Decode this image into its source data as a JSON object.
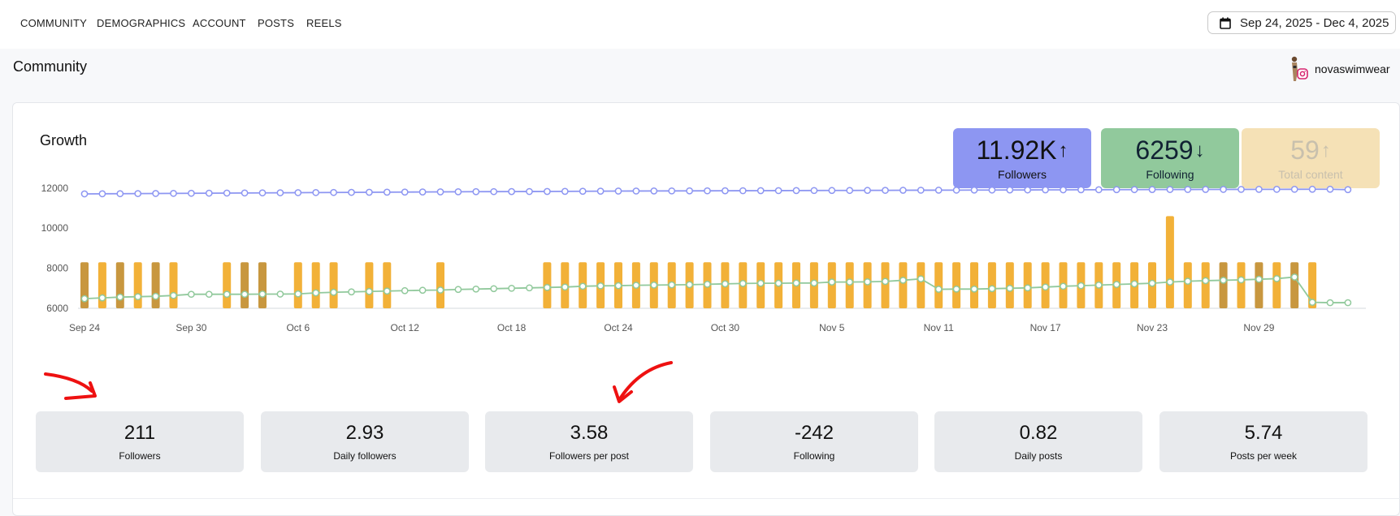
{
  "nav": {
    "tabs": [
      "COMMUNITY",
      "DEMOGRAPHICS",
      "ACCOUNT",
      "POSTS",
      "REELS"
    ],
    "date_range": "Sep 24, 2025 - Dec 4, 2025"
  },
  "page": {
    "title": "Community",
    "account_name": "novaswimwear"
  },
  "growth": {
    "title": "Growth",
    "kpis": [
      {
        "value": "11.92K",
        "arrow": "↑",
        "label": "Followers",
        "color": "#8d96f2"
      },
      {
        "value": "6259",
        "arrow": "↓",
        "label": "Following",
        "color": "#91c99c"
      },
      {
        "value": "59",
        "arrow": "↑",
        "label": "Total content",
        "color": "#f5e1b6"
      }
    ],
    "stats": [
      {
        "value": "211",
        "label": "Followers"
      },
      {
        "value": "2.93",
        "label": "Daily followers"
      },
      {
        "value": "3.58",
        "label": "Followers per post"
      },
      {
        "value": "-242",
        "label": "Following"
      },
      {
        "value": "0.82",
        "label": "Daily posts"
      },
      {
        "value": "5.74",
        "label": "Posts per week"
      }
    ]
  },
  "chart_data": {
    "type": "line",
    "y_ticks": [
      6000,
      8000,
      10000,
      12000
    ],
    "ylim": [
      6000,
      12000
    ],
    "x_tick_labels": [
      "Sep 24",
      "Sep 30",
      "Oct 6",
      "Oct 12",
      "Oct 18",
      "Oct 24",
      "Oct 30",
      "Nov 5",
      "Nov 11",
      "Nov 17",
      "Nov 23",
      "Nov 29"
    ],
    "x": [
      "Sep 24",
      "Sep 25",
      "Sep 26",
      "Sep 27",
      "Sep 28",
      "Sep 29",
      "Sep 30",
      "Oct 1",
      "Oct 2",
      "Oct 3",
      "Oct 4",
      "Oct 5",
      "Oct 6",
      "Oct 7",
      "Oct 8",
      "Oct 9",
      "Oct 10",
      "Oct 11",
      "Oct 12",
      "Oct 13",
      "Oct 14",
      "Oct 15",
      "Oct 16",
      "Oct 17",
      "Oct 18",
      "Oct 19",
      "Oct 20",
      "Oct 21",
      "Oct 22",
      "Oct 23",
      "Oct 24",
      "Oct 25",
      "Oct 26",
      "Oct 27",
      "Oct 28",
      "Oct 29",
      "Oct 30",
      "Oct 31",
      "Nov 1",
      "Nov 2",
      "Nov 3",
      "Nov 4",
      "Nov 5",
      "Nov 6",
      "Nov 7",
      "Nov 8",
      "Nov 9",
      "Nov 10",
      "Nov 11",
      "Nov 12",
      "Nov 13",
      "Nov 14",
      "Nov 15",
      "Nov 16",
      "Nov 17",
      "Nov 18",
      "Nov 19",
      "Nov 20",
      "Nov 21",
      "Nov 22",
      "Nov 23",
      "Nov 24",
      "Nov 25",
      "Nov 26",
      "Nov 27",
      "Nov 28",
      "Nov 29",
      "Nov 30",
      "Dec 1",
      "Dec 2",
      "Dec 3",
      "Dec 4"
    ],
    "series": [
      {
        "color": "#8d96f2",
        "values": [
          11710,
          11715,
          11720,
          11725,
          11730,
          11735,
          11740,
          11745,
          11750,
          11755,
          11760,
          11765,
          11770,
          11775,
          11780,
          11785,
          11790,
          11795,
          11800,
          11805,
          11810,
          11815,
          11820,
          11822,
          11825,
          11828,
          11830,
          11835,
          11840,
          11845,
          11850,
          11852,
          11855,
          11858,
          11860,
          11862,
          11865,
          11868,
          11870,
          11872,
          11875,
          11878,
          11880,
          11882,
          11885,
          11887,
          11890,
          11893,
          11895,
          11897,
          11900,
          11902,
          11905,
          11907,
          11910,
          11912,
          11915,
          11917,
          11920,
          11922,
          11925,
          11927,
          11929,
          11930,
          11932,
          11934,
          11935,
          11937,
          11938,
          11940,
          11940,
          11921
        ]
      },
      {
        "color": "#91c99c",
        "values": [
          6480,
          6520,
          6560,
          6580,
          6600,
          6640,
          6700,
          6700,
          6700,
          6700,
          6710,
          6710,
          6720,
          6770,
          6800,
          6820,
          6840,
          6860,
          6880,
          6900,
          6910,
          6940,
          6960,
          6980,
          7000,
          7020,
          7040,
          7060,
          7100,
          7120,
          7130,
          7150,
          7160,
          7170,
          7180,
          7200,
          7220,
          7240,
          7250,
          7250,
          7260,
          7260,
          7310,
          7310,
          7320,
          7340,
          7400,
          7470,
          6950,
          6960,
          6960,
          6980,
          7000,
          7020,
          7060,
          7100,
          7130,
          7160,
          7190,
          7220,
          7250,
          7310,
          7350,
          7380,
          7400,
          7420,
          7450,
          7480,
          7560,
          6300,
          6280,
          6280
        ]
      },
      {
        "color": "#f2b138",
        "values": [
          8300,
          8300,
          8300,
          8300,
          8300,
          8300,
          0,
          0,
          8300,
          8300,
          8300,
          0,
          8300,
          8300,
          8300,
          0,
          8300,
          8300,
          0,
          0,
          8300,
          0,
          0,
          0,
          0,
          0,
          8300,
          8300,
          8300,
          8300,
          8300,
          8300,
          8300,
          8300,
          8300,
          8300,
          8300,
          8300,
          8300,
          8300,
          8300,
          8300,
          8300,
          8300,
          8300,
          8300,
          8300,
          8300,
          8300,
          8300,
          8300,
          8300,
          8300,
          8300,
          8300,
          8300,
          8300,
          8300,
          8300,
          8300,
          8300,
          10600,
          8300,
          8300,
          8300,
          8300,
          8300,
          8300,
          8300,
          8300,
          0,
          0
        ]
      }
    ]
  }
}
